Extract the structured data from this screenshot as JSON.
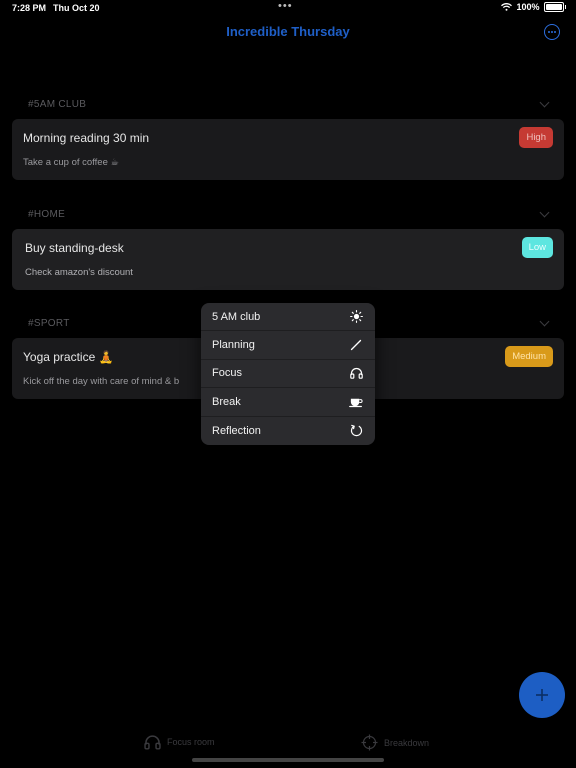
{
  "status": {
    "time": "7:28 PM",
    "date": "Thu Oct 20",
    "battery": "100%"
  },
  "header": {
    "title": "Incredible Thursday"
  },
  "sections": [
    {
      "tag": "#5AM CLUB",
      "task": {
        "title": "Morning reading 30 min",
        "note": "Take a cup of coffee ☕",
        "priority": "High",
        "color": "#c53a33"
      }
    },
    {
      "tag": "#HOME",
      "task": {
        "title": "Buy standing-desk",
        "note": "Check amazon's discount",
        "priority": "Low",
        "color": "#5de6e0"
      }
    },
    {
      "tag": "#SPORT",
      "task": {
        "title": "Yoga practice 🧘",
        "note": "Kick off the day with care of mind & b",
        "priority": "Medium",
        "color": "#d99a1a"
      }
    }
  ],
  "menu": {
    "items": [
      {
        "label": "5 AM club",
        "icon": "sun-icon"
      },
      {
        "label": "Planning",
        "icon": "pencil-icon"
      },
      {
        "label": "Focus",
        "icon": "headphones-icon"
      },
      {
        "label": "Break",
        "icon": "cup-icon"
      },
      {
        "label": "Reflection",
        "icon": "refresh-icon"
      }
    ]
  },
  "tabs": [
    {
      "label": "Focus room",
      "icon": "headphones-icon"
    },
    {
      "label": "Breakdown",
      "icon": "crosshair-icon"
    }
  ],
  "colors": {
    "accent": "#1d5ec4",
    "title": "#1f5fc7",
    "background": "#000000",
    "card": "#1a1a1c"
  }
}
